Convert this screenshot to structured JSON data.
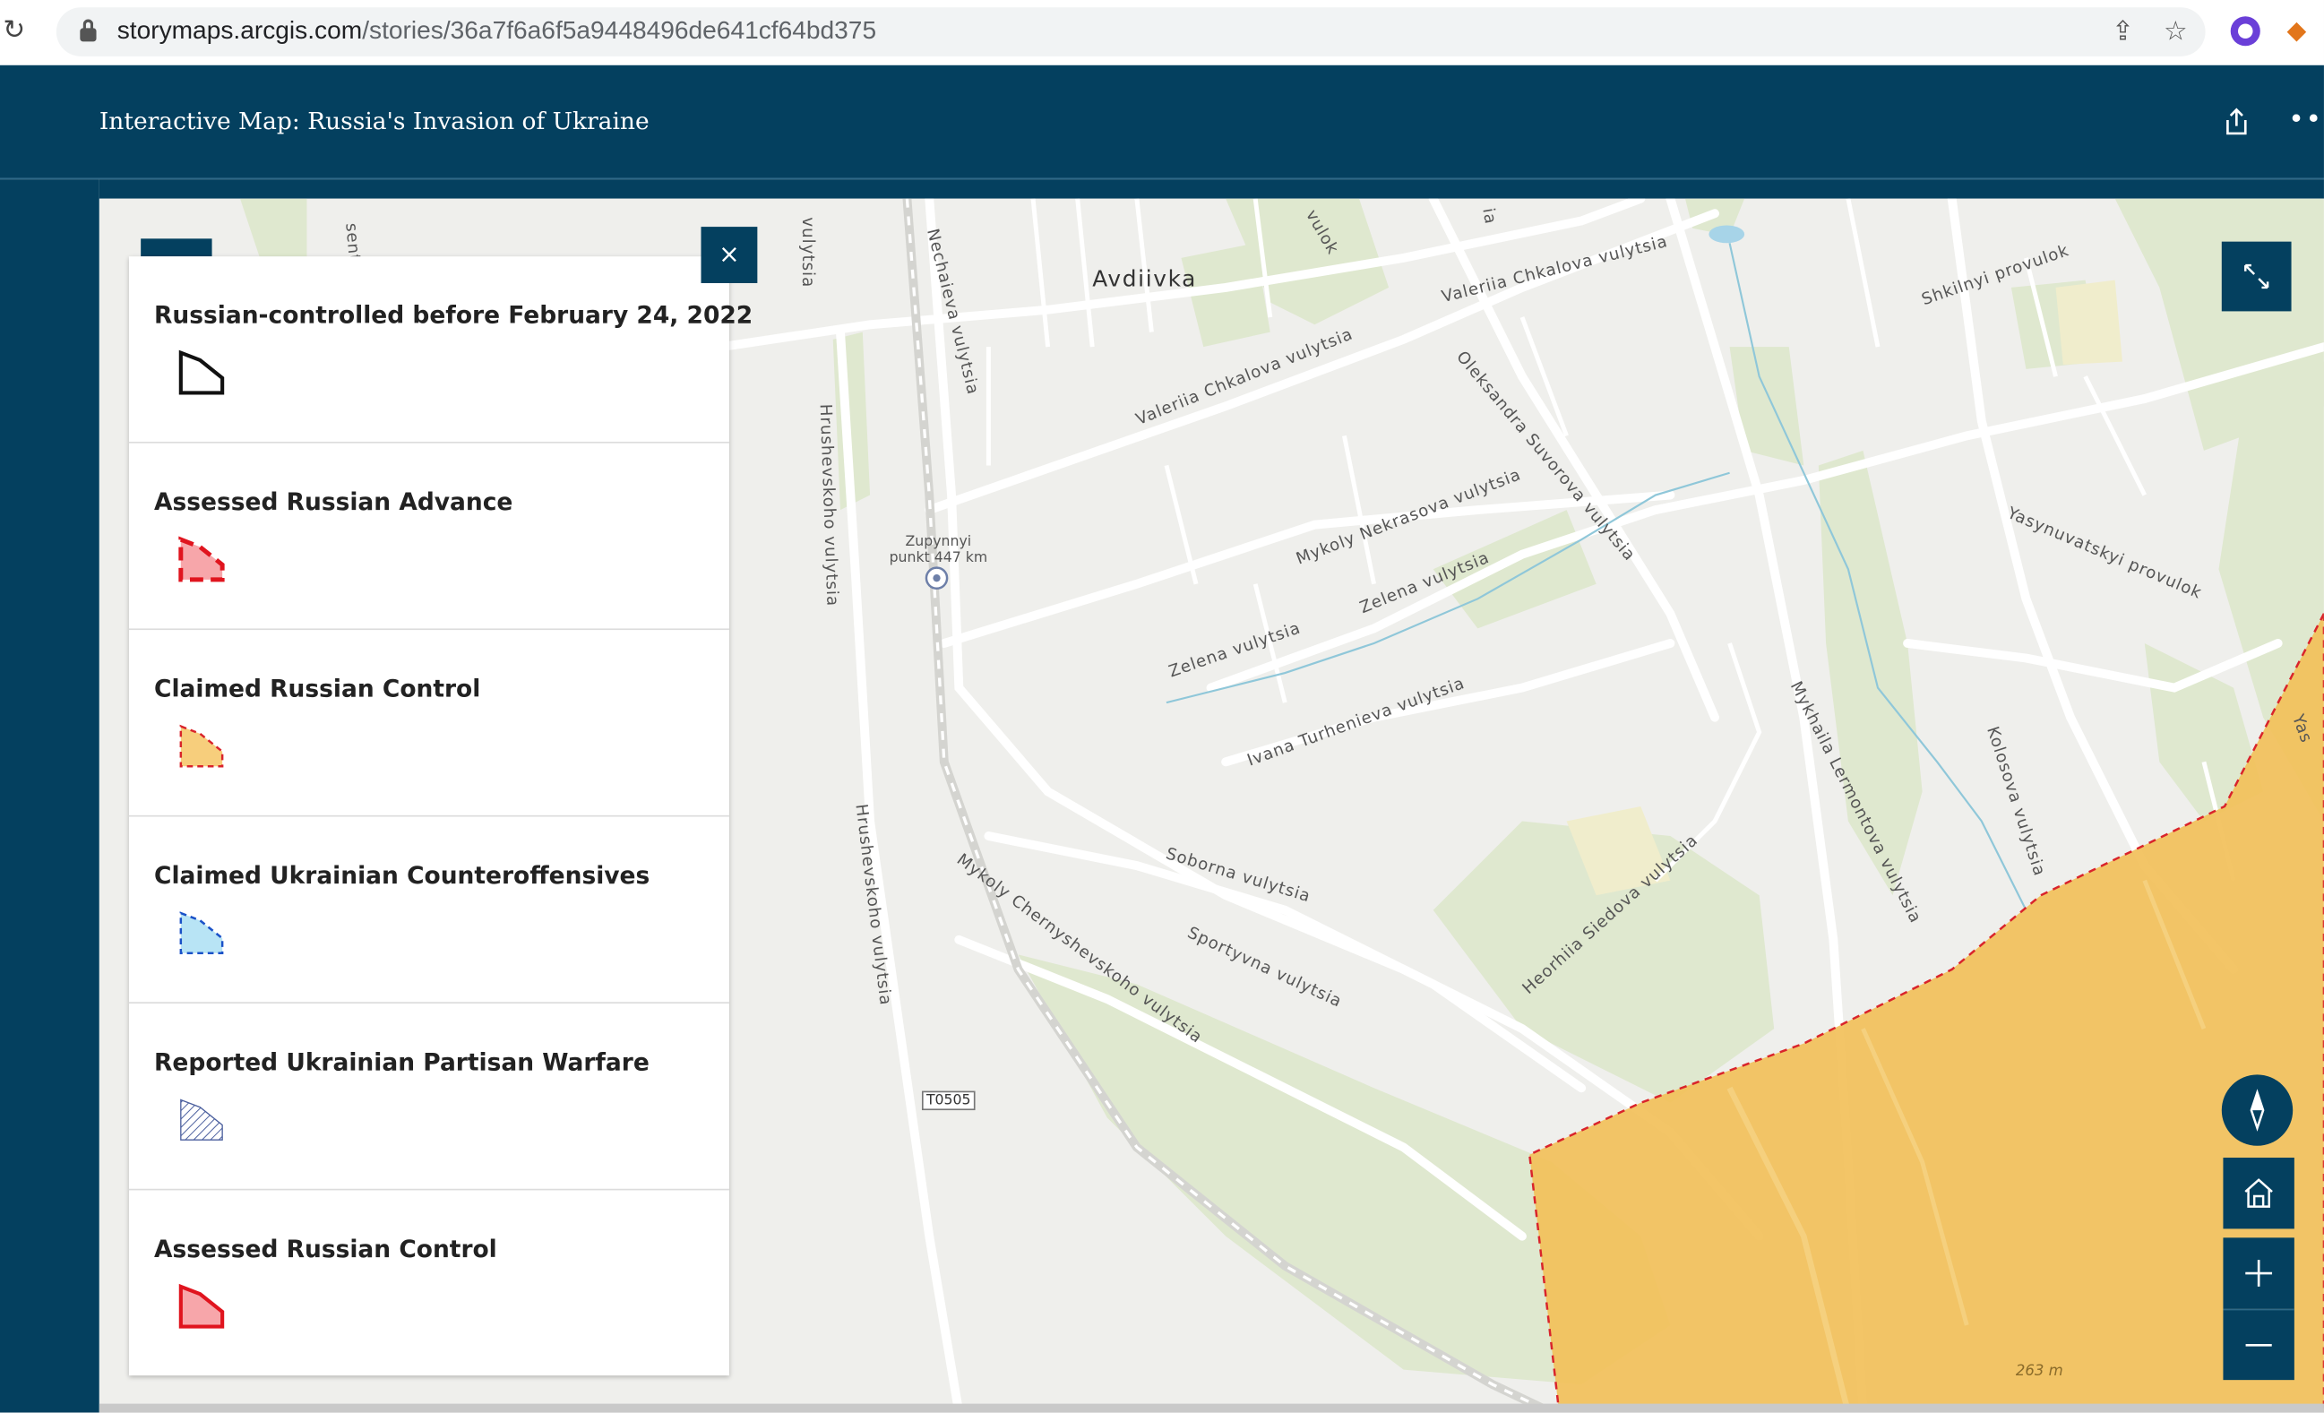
{
  "browser": {
    "url_host": "storymaps.arcgis.com",
    "url_path": "/stories/36a7f6a6f5a9448496de641cf64bd375"
  },
  "header": {
    "title": "Interactive Map: Russia's Invasion of Ukraine",
    "more_label": "•••"
  },
  "legend": {
    "close_label": "×",
    "items": [
      {
        "label": "Russian-controlled before February 24, 2022",
        "swatch": "black-outline"
      },
      {
        "label": "Assessed Russian Advance",
        "swatch": "red-dashed-pink"
      },
      {
        "label": "Claimed Russian Control",
        "swatch": "orange-dashed"
      },
      {
        "label": "Claimed Ukrainian Counteroffensives",
        "swatch": "blue-dashed"
      },
      {
        "label": "Reported Ukrainian Partisan Warfare",
        "swatch": "hatched-blue"
      },
      {
        "label": "Assessed Russian Control",
        "swatch": "red-solid-pink"
      }
    ]
  },
  "map": {
    "city": "Avdiivka",
    "poi": [
      "Zupynnyi",
      "punkt 447 km"
    ],
    "road_badge": "T0505",
    "elevation": "263 m",
    "streets": {
      "s1": "sentra",
      "s2": "vulytsia",
      "s3": "Nechaieva vulytsia",
      "s4": "vulok",
      "s5": "Valeriia Chkalova vulytsia",
      "s6": "Valeriia Chkalova vulytsia",
      "s7": "Shkilnyi provulok",
      "s8": "Oleksandra Suvorova vulytsia",
      "s9": "Hrushevskoho vulytsia",
      "s10": "Mykoly Nekrasova vulytsia",
      "s11": "Yasynuvatskyi provulok",
      "s12": "Zelena vulytsia",
      "s13": "Zelena vulytsia",
      "s14": "Ivana Turhenieva vulytsia",
      "s15": "Mykhaila Lermontova vulytsia",
      "s16": "Kolosova vulytsia",
      "s17": "Hrushevskoho vulytsia",
      "s18": "Mykoly Chernyshevskoho vulytsia",
      "s19": "Soborna vulytsia",
      "s20": "Sportyvna vulytsia",
      "s21": "Heorhiia Siedova vulytsia",
      "s22": "ia",
      "s23": "Yas"
    }
  },
  "colors": {
    "header": "#04405f",
    "claimed_control_fill": "#f2c05a",
    "claimed_control_border": "#d9242b"
  }
}
